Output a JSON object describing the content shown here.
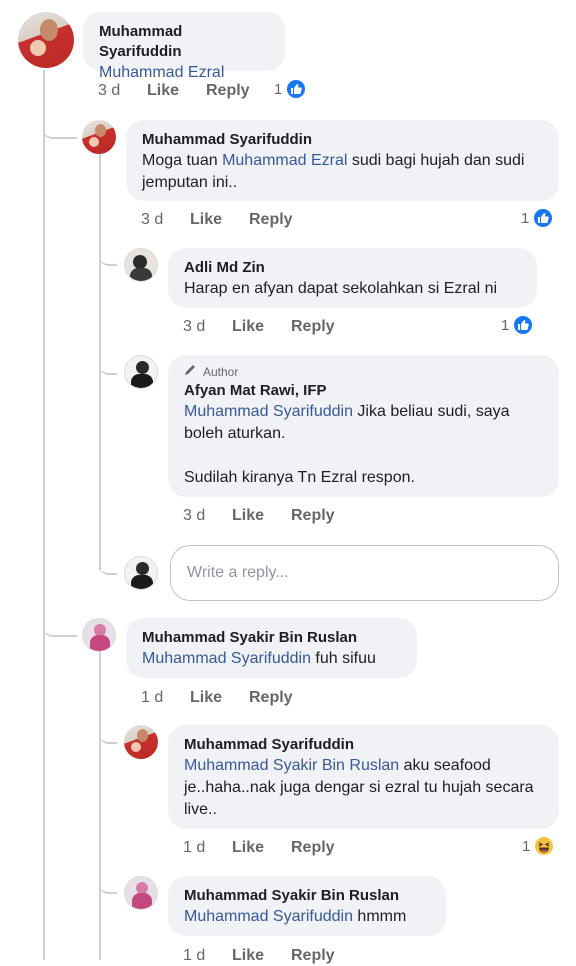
{
  "comments": {
    "c1": {
      "name": "Muhammad Syarifuddin",
      "mention": "Muhammad Ezral",
      "body": "",
      "time": "3 d",
      "like": "Like",
      "reply": "Reply",
      "reactions": "1"
    },
    "c2": {
      "name": "Muhammad Syarifuddin",
      "prefix": "Moga tuan ",
      "mention": "Muhammad Ezral",
      "body": " sudi bagi hujah dan sudi jemputan ini..",
      "time": "3 d",
      "like": "Like",
      "reply": "Reply",
      "reactions": "1"
    },
    "c3": {
      "name": "Adli Md Zin",
      "body": "Harap en afyan dapat sekolahkan si Ezral ni",
      "time": "3 d",
      "like": "Like",
      "reply": "Reply",
      "reactions": "1"
    },
    "c4": {
      "badge": "Author",
      "name": "Afyan Mat Rawi, IFP",
      "mention": "Muhammad Syarifuddin",
      "body": " Jika beliau sudi, saya boleh aturkan.",
      "body2": "Sudilah kiranya Tn Ezral respon.",
      "time": "3 d",
      "like": "Like",
      "reply": "Reply"
    },
    "c5": {
      "name": "Muhammad Syakir Bin Ruslan",
      "mention": "Muhammad Syarifuddin",
      "body": " fuh sifuu",
      "time": "1 d",
      "like": "Like",
      "reply": "Reply"
    },
    "c6": {
      "name": "Muhammad Syarifuddin",
      "mention": "Muhammad Syakir Bin Ruslan",
      "body": " aku seafood je..haha..nak juga dengar si ezral tu hujah secara live..",
      "time": "1 d",
      "like": "Like",
      "reply": "Reply",
      "reactions": "1"
    },
    "c7": {
      "name": "Muhammad Syakir Bin Ruslan",
      "mention": "Muhammad Syarifuddin",
      "body": " hmmm",
      "time": "1 d",
      "like": "Like",
      "reply": "Reply"
    }
  },
  "reply_box": {
    "placeholder": "Write a reply..."
  },
  "icons": {
    "like": "thumbs-up-icon",
    "haha": "haha-emoji-icon",
    "author": "pencil-icon"
  },
  "colors": {
    "mention": "#385898",
    "like_blue": "#1877f2",
    "bubble": "#f0f2f5"
  }
}
